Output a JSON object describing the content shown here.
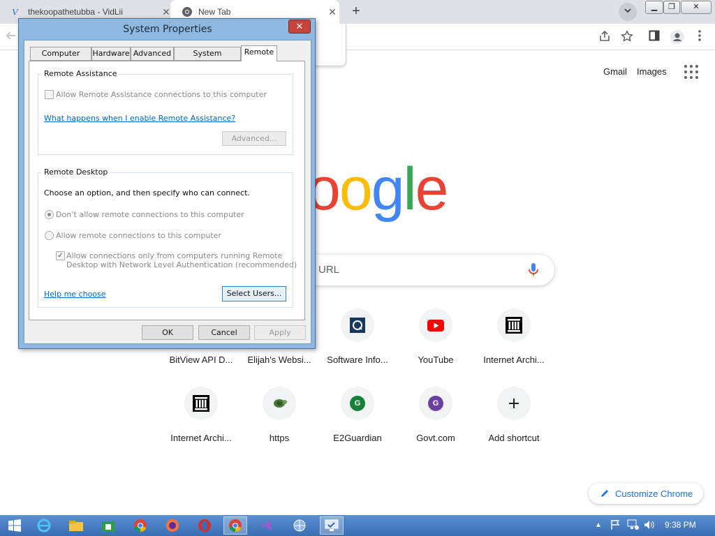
{
  "browser": {
    "tabs": [
      {
        "title": "thekoopathetubba - VidLii",
        "icon": "vidlii-icon",
        "active": false
      },
      {
        "title": "New Tab",
        "icon": "chrome-icon",
        "active": true
      }
    ],
    "new_tab_symbol": "+",
    "close_symbol": "✕",
    "window_controls": [
      "▁",
      "❐",
      "✕"
    ]
  },
  "ntp": {
    "header_links": [
      "Gmail",
      "Images"
    ],
    "logo_visible": "oogle",
    "logo_colors": {
      "o1": "#ea4335",
      "o2": "#fbbc05",
      "g": "#4285f4",
      "l": "#34a853",
      "e": "#ea4335"
    },
    "search_placeholder_visible": "URL",
    "shortcuts": [
      {
        "label": "BitView API D...",
        "icon": "none"
      },
      {
        "label": "Elijah's Websi...",
        "icon": "none"
      },
      {
        "label": "Software Info...",
        "icon": "software-info-icon"
      },
      {
        "label": "YouTube",
        "icon": "youtube-icon"
      },
      {
        "label": "Internet Archi...",
        "icon": "internet-archive-icon"
      },
      {
        "label": "Internet Archi...",
        "icon": "internet-archive-icon"
      },
      {
        "label": "https",
        "icon": "turtle-icon"
      },
      {
        "label": "E2Guardian",
        "icon": "letter-g-green-icon",
        "letter": "G",
        "color": "#188038"
      },
      {
        "label": "Govt.com",
        "icon": "letter-g-purple-icon",
        "letter": "G",
        "color": "#6b3fa0"
      },
      {
        "label": "Add shortcut",
        "icon": "plus-icon"
      }
    ],
    "customize_label": "Customize Chrome"
  },
  "dialog": {
    "title": "System Properties",
    "tabs": [
      "Computer Name",
      "Hardware",
      "Advanced",
      "System Protection",
      "Remote"
    ],
    "active_tab": "Remote",
    "remote_assistance": {
      "group_title": "Remote Assistance",
      "allow_label": "Allow Remote Assistance connections to this computer",
      "help_link": "What happens when I enable Remote Assistance?",
      "advanced_button": "Advanced..."
    },
    "remote_desktop": {
      "group_title": "Remote Desktop",
      "instruction": "Choose an option, and then specify who can connect.",
      "option_dont_allow": "Don’t allow remote connections to this computer",
      "option_allow": "Allow remote connections to this computer",
      "nla_line1": "Allow connections only from computers running Remote",
      "nla_line2": "Desktop with Network Level Authentication (recommended)",
      "help_link": "Help me choose",
      "select_users_button": "Select Users..."
    },
    "buttons": {
      "ok": "OK",
      "cancel": "Cancel",
      "apply": "Apply"
    },
    "close_symbol": "✕"
  },
  "taskbar": {
    "clock": "9:38 PM",
    "accent": "#3a6eb4"
  }
}
